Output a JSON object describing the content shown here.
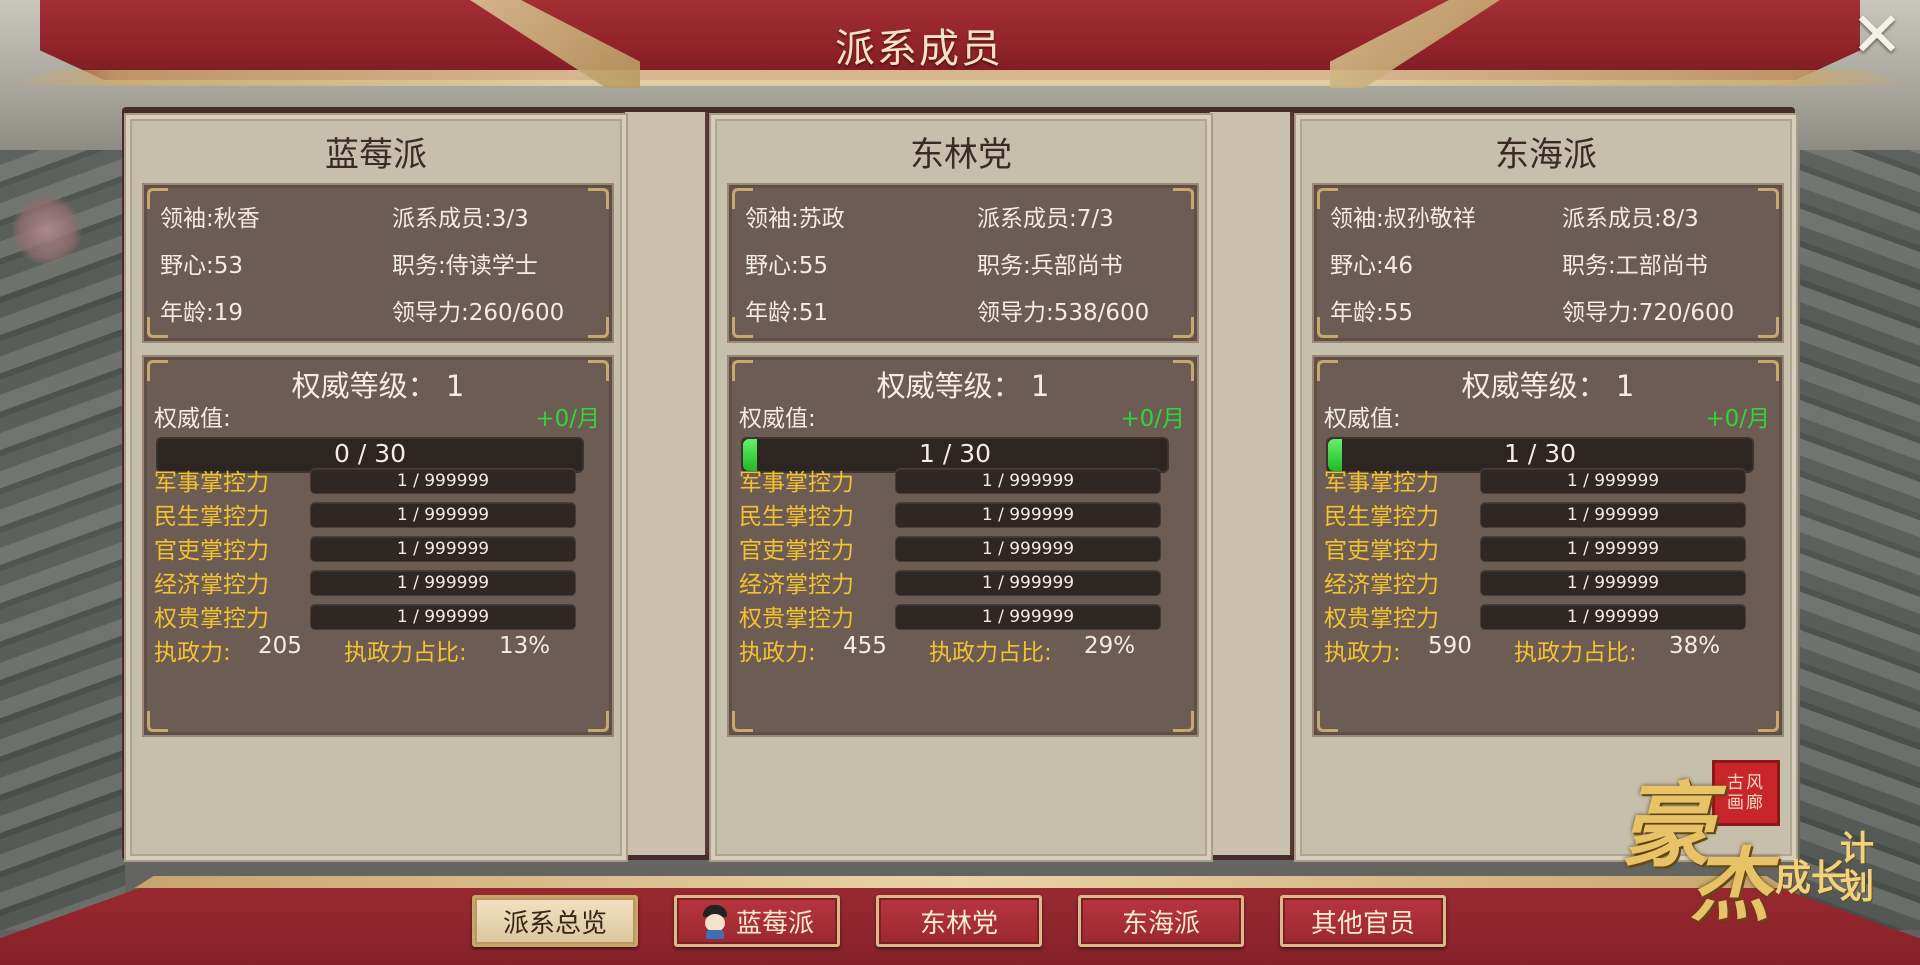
{
  "header": {
    "title": "派系成员",
    "close_icon": "close-icon"
  },
  "factions": [
    {
      "name": "蓝莓派",
      "leader": "领袖:秋香",
      "members": "派系成员:3/3",
      "ambition": "野心:53",
      "position": "职务:侍读学士",
      "age": "年龄:19",
      "leadership": "领导力:260/600",
      "authority_level": "权威等级： 1",
      "authority_label": "权威值:",
      "authority_rate": "+0/月",
      "authority_value": "0 / 30",
      "authority_progress": 0,
      "controls": [
        {
          "label": "军事掌控力",
          "value": "1 / 999999"
        },
        {
          "label": "民生掌控力",
          "value": "1 / 999999"
        },
        {
          "label": "官吏掌控力",
          "value": "1 / 999999"
        },
        {
          "label": "经济掌控力",
          "value": "1 / 999999"
        },
        {
          "label": "权贵掌控力",
          "value": "1 / 999999"
        }
      ],
      "power_label": "执政力:",
      "power_value": "205",
      "ratio_label": "执政力占比:",
      "ratio_value": "13%"
    },
    {
      "name": "东林党",
      "leader": "领袖:苏政",
      "members": "派系成员:7/3",
      "ambition": "野心:55",
      "position": "职务:兵部尚书",
      "age": "年龄:51",
      "leadership": "领导力:538/600",
      "authority_level": "权威等级： 1",
      "authority_label": "权威值:",
      "authority_rate": "+0/月",
      "authority_value": "1 / 30",
      "authority_progress": 0.0333,
      "controls": [
        {
          "label": "军事掌控力",
          "value": "1 / 999999"
        },
        {
          "label": "民生掌控力",
          "value": "1 / 999999"
        },
        {
          "label": "官吏掌控力",
          "value": "1 / 999999"
        },
        {
          "label": "经济掌控力",
          "value": "1 / 999999"
        },
        {
          "label": "权贵掌控力",
          "value": "1 / 999999"
        }
      ],
      "power_label": "执政力:",
      "power_value": "455",
      "ratio_label": "执政力占比:",
      "ratio_value": "29%"
    },
    {
      "name": "东海派",
      "leader": "领袖:叔孙敬祥",
      "members": "派系成员:8/3",
      "ambition": "野心:46",
      "position": "职务:工部尚书",
      "age": "年龄:55",
      "leadership": "领导力:720/600",
      "authority_level": "权威等级： 1",
      "authority_label": "权威值:",
      "authority_rate": "+0/月",
      "authority_value": "1 / 30",
      "authority_progress": 0.0333,
      "controls": [
        {
          "label": "军事掌控力",
          "value": "1 / 999999"
        },
        {
          "label": "民生掌控力",
          "value": "1 / 999999"
        },
        {
          "label": "官吏掌控力",
          "value": "1 / 999999"
        },
        {
          "label": "经济掌控力",
          "value": "1 / 999999"
        },
        {
          "label": "权贵掌控力",
          "value": "1 / 999999"
        }
      ],
      "power_label": "执政力:",
      "power_value": "590",
      "ratio_label": "执政力占比:",
      "ratio_value": "38%"
    }
  ],
  "tabs": [
    {
      "label": "派系总览",
      "active": true
    },
    {
      "label": "蓝莓派",
      "active": false,
      "icon": "character-avatar-icon"
    },
    {
      "label": "东林党",
      "active": false
    },
    {
      "label": "东海派",
      "active": false
    },
    {
      "label": "其他官员",
      "active": false
    }
  ],
  "logo": {
    "main_chars": [
      "豪",
      "杰"
    ],
    "side_chars": [
      "成长",
      "计划"
    ],
    "seal_text": "古风 画廊"
  },
  "colors": {
    "banner_red": "#8f2329",
    "gold_trim": "#d8b985",
    "panel_brown": "#6c5c54",
    "card_beige": "#c6bfab",
    "control_label": "#f2c230",
    "rate_green": "#34d33a",
    "progress_green": "#39c23c"
  }
}
